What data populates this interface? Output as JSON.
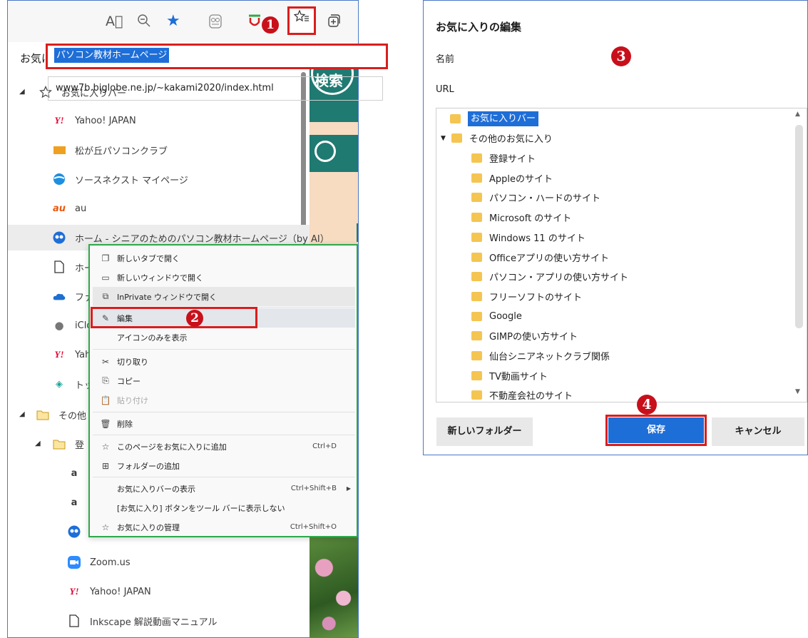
{
  "browser": {
    "toolbar": {
      "read_aloud_icon": "A⃨",
      "badge1": "1"
    }
  },
  "favorites": {
    "title": "お気に入り",
    "items": [
      {
        "label": "お気に入りバー",
        "icon": "star-outline-icon"
      },
      {
        "label": "Yahoo! JAPAN",
        "icon": "yahoo-icon"
      },
      {
        "label": "松が丘パソコンクラブ",
        "icon": "club-logo-icon"
      },
      {
        "label": "ソースネクスト マイページ",
        "icon": "sourcenext-icon"
      },
      {
        "label": "au",
        "icon": "au-icon"
      },
      {
        "label": "ホーム - シニアのためのパソコン教材ホームページ（by AI）",
        "icon": "owl-icon"
      },
      {
        "label": "ホー",
        "icon": "page-icon"
      },
      {
        "label": "ファ",
        "icon": "onedrive-icon"
      },
      {
        "label": "iClo",
        "icon": "apple-icon"
      },
      {
        "label": "Yah",
        "icon": "yahoo-icon"
      },
      {
        "label": "トッ",
        "icon": "diamond-icon"
      },
      {
        "label": "その他",
        "icon": "folder-icon"
      },
      {
        "label": "登",
        "icon": "folder-icon"
      },
      {
        "label": "Zoom.us",
        "icon": "zoom-icon"
      },
      {
        "label": "Yahoo! JAPAN",
        "icon": "yahoo-icon"
      },
      {
        "label": "Inkscape 解説動画マニュアル",
        "icon": "page-icon"
      }
    ]
  },
  "context_menu": {
    "items": [
      {
        "label": "新しいタブで開く"
      },
      {
        "label": "新しいウィンドウで開く"
      },
      {
        "label": "InPrivate ウィンドウで開く"
      },
      {
        "label": "編集"
      },
      {
        "label": "アイコンのみを表示"
      },
      {
        "label": "切り取り"
      },
      {
        "label": "コピー"
      },
      {
        "label": "貼り付け"
      },
      {
        "label": "削除"
      },
      {
        "label": "このページをお気に入りに追加",
        "shortcut": "Ctrl+D"
      },
      {
        "label": "フォルダーの追加"
      },
      {
        "label": "お気に入りバーの表示",
        "shortcut": "Ctrl+Shift+B"
      },
      {
        "label": "[お気に入り] ボタンをツール バーに表示しない"
      },
      {
        "label": "お気に入りの管理",
        "shortcut": "Ctrl+Shift+O"
      }
    ],
    "badge2": "2"
  },
  "edit_dialog": {
    "title": "お気に入りの編集",
    "name_label": "名前",
    "name_value": "パソコン教材ホームページ",
    "url_label": "URL",
    "url_value": "www7b.biglobe.ne.jp/~kakami2020/index.html",
    "badge3": "3",
    "badge4": "4",
    "folders": [
      "お気に入りバー",
      "その他のお気に入り",
      "登録サイト",
      "Appleのサイト",
      "パソコン・ハードのサイト",
      "Microsoft のサイト",
      "Windows 11 のサイト",
      "Officeアプリの使い方サイト",
      "パソコン・アプリの使い方サイト",
      "フリーソフトのサイト",
      "Google",
      "GIMPの使い方サイト",
      "仙台シニアネットクラブ関係",
      "TV動画サイト",
      "不動産会社のサイト"
    ],
    "new_folder_label": "新しいフォルダー",
    "save_label": "保存",
    "cancel_label": "キャンセル"
  },
  "page_background": {
    "search_text": "検索"
  },
  "colors": {
    "accent": "#1e6ed8",
    "highlight_red": "#d81e1e",
    "menu_border": "#2fa84a",
    "teal": "#1f7a72"
  }
}
